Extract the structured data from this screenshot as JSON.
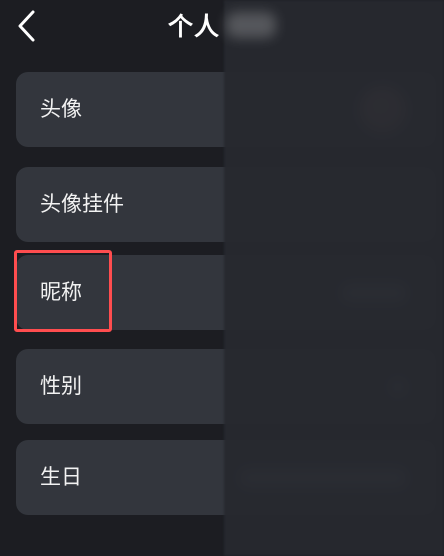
{
  "header": {
    "title": "个人",
    "back_icon": "chevron-left-icon"
  },
  "rows": [
    {
      "label": "头像"
    },
    {
      "label": "头像挂件"
    },
    {
      "label": "昵称"
    },
    {
      "label": "性别"
    },
    {
      "label": "生日"
    }
  ],
  "colors": {
    "background": "#1c1d22",
    "row_background": "#33363d",
    "text": "#f2f2f2",
    "highlight": "#ff4d4f"
  }
}
